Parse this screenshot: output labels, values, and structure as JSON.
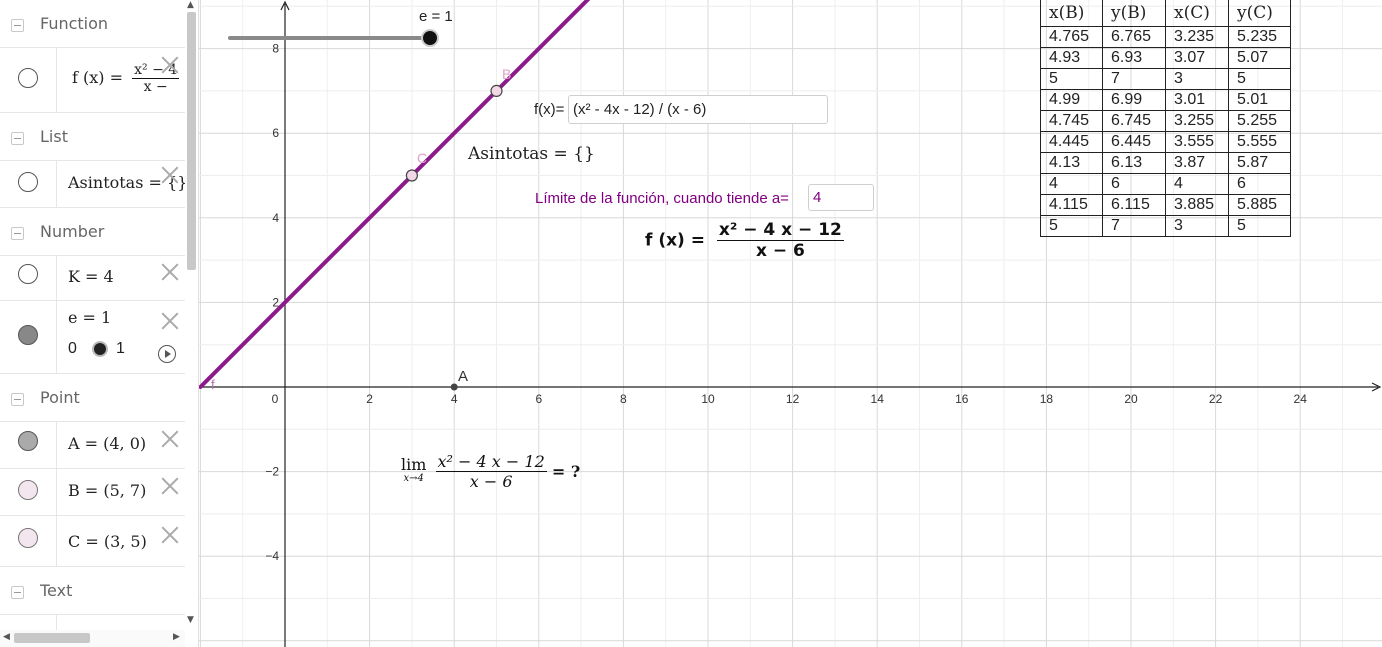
{
  "algebra": {
    "categories": {
      "function": "Function",
      "list": "List",
      "number": "Number",
      "point": "Point",
      "text": "Text"
    },
    "f_item": {
      "name": "f (x) =",
      "numerator": "x² − 4",
      "denominator": "x −",
      "color": "#cc88cc"
    },
    "asintotas_item": {
      "text": "Asintotas = {}",
      "color": "#88c088"
    },
    "k_item": {
      "text": "K = 4"
    },
    "e_item": {
      "text": "e = 1",
      "slider_min": "0",
      "slider_max": "1"
    },
    "points": [
      {
        "text": "A = (4, 0)",
        "color": "#aaaaaa"
      },
      {
        "text": "B = (5, 7)",
        "color": "#f3e6ee"
      },
      {
        "text": "C = (3, 5)",
        "color": "#f3e6ee"
      }
    ]
  },
  "graphics": {
    "slider_label": "e = 1",
    "slider_value": 1,
    "function_input_label": "f(x)=",
    "function_input_value": "(x² - 4x - 12) / (x - 6)",
    "asintotas_text": "Asintotas = {}",
    "limit_label": "Límite de la función, cuando tiende a=",
    "limit_value": "4",
    "formula": {
      "lhs": "f (x) =",
      "num": "x² − 4 x − 12",
      "den": "x − 6"
    },
    "limit_formula": {
      "lim": "lim",
      "sub": "x→4",
      "num": "x² − 4 x − 12",
      "den": "x − 6",
      "rhs": "= ?"
    },
    "point_labels": {
      "A": "A",
      "B": "B",
      "C": "C",
      "f": "f"
    },
    "axis": {
      "x_ticks": [
        "0",
        "2",
        "4",
        "6",
        "8",
        "10",
        "12",
        "14",
        "16",
        "18",
        "20",
        "22",
        "24"
      ],
      "y_ticks": [
        "8",
        "6",
        "4",
        "2",
        "−2",
        "−4"
      ]
    },
    "colors": {
      "function": "#8b1a8b",
      "label": "#800080"
    }
  },
  "table": {
    "headers": [
      "x(B)",
      "y(B)",
      "x(C)",
      "y(C)"
    ],
    "rows": [
      [
        "4.765",
        "6.765",
        "3.235",
        "5.235"
      ],
      [
        "4.93",
        "6.93",
        "3.07",
        "5.07"
      ],
      [
        "5",
        "7",
        "3",
        "5"
      ],
      [
        "4.99",
        "6.99",
        "3.01",
        "5.01"
      ],
      [
        "4.745",
        "6.745",
        "3.255",
        "5.255"
      ],
      [
        "4.445",
        "6.445",
        "3.555",
        "5.555"
      ],
      [
        "4.13",
        "6.13",
        "3.87",
        "5.87"
      ],
      [
        "4",
        "6",
        "4",
        "6"
      ],
      [
        "4.115",
        "6.115",
        "3.885",
        "5.885"
      ],
      [
        "5",
        "7",
        "3",
        "5"
      ]
    ]
  }
}
